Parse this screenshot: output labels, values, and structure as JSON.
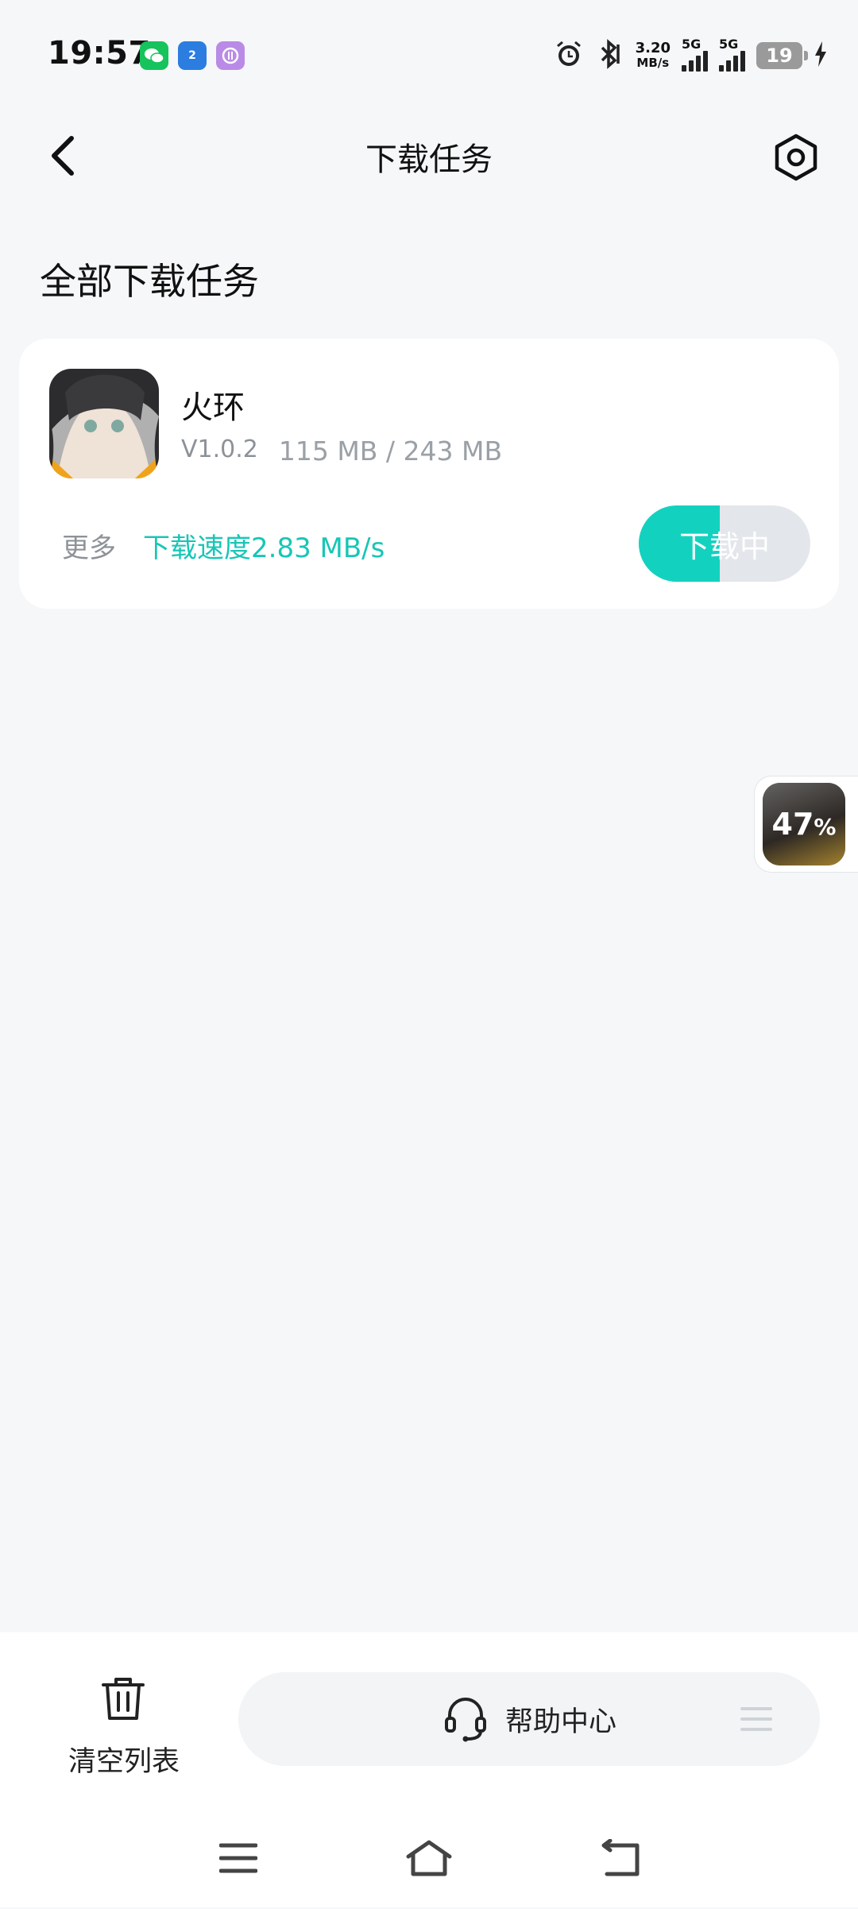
{
  "status_bar": {
    "time": "19:57",
    "hotspot_badge": "2",
    "speed_value": "3.20",
    "speed_unit": "MB/s",
    "signal1_label": "5G",
    "signal2_label": "5G",
    "battery": "19"
  },
  "header": {
    "title": "下载任务"
  },
  "section": {
    "title": "全部下载任务"
  },
  "task": {
    "app_name": "火环",
    "version": "V1.0.2",
    "size": "115 MB / 243 MB",
    "more_label": "更多",
    "speed_label": "下载速度",
    "speed_value": "2.83 MB/s",
    "button_label": "下载中",
    "progress_percent": 47
  },
  "float_widget": {
    "percent": "47",
    "percent_sign": "%"
  },
  "bottom": {
    "clear_label": "清空列表",
    "help_label": "帮助中心"
  },
  "colors": {
    "accent": "#12d2bf",
    "speed_text": "#17c6b6",
    "background": "#f5f7f9"
  },
  "icons": [
    "back-arrow",
    "settings-hexagon",
    "trash",
    "headset",
    "menu",
    "home",
    "back"
  ]
}
